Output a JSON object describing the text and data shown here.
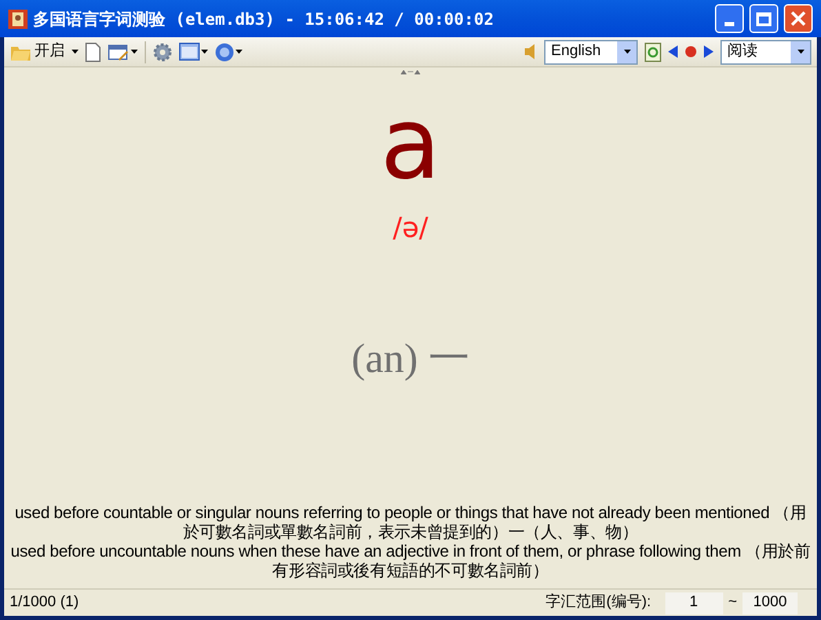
{
  "window": {
    "title": "多国语言字词测验 (elem.db3) - 15:06:42 / 00:00:02"
  },
  "toolbar": {
    "open_label": "开启",
    "language": "English",
    "mode": "阅读"
  },
  "word": {
    "headword": "a",
    "phonetic": "/ə/",
    "meaning": "(an) 一"
  },
  "definitions": [
    "used before countable or singular nouns referring to people or things that have not already been mentioned （用於可數名詞或單數名詞前，表示未曾提到的）一（人、事、物）",
    "used before uncountable nouns when these have an adjective in front of them, or phrase following them （用於前有形容詞或後有短語的不可數名詞前）"
  ],
  "status_bar": {
    "position": "1/1000 (1)",
    "range_label": "字汇范围(编号):",
    "range_from": "1",
    "range_sep": "~",
    "range_to": "1000"
  }
}
